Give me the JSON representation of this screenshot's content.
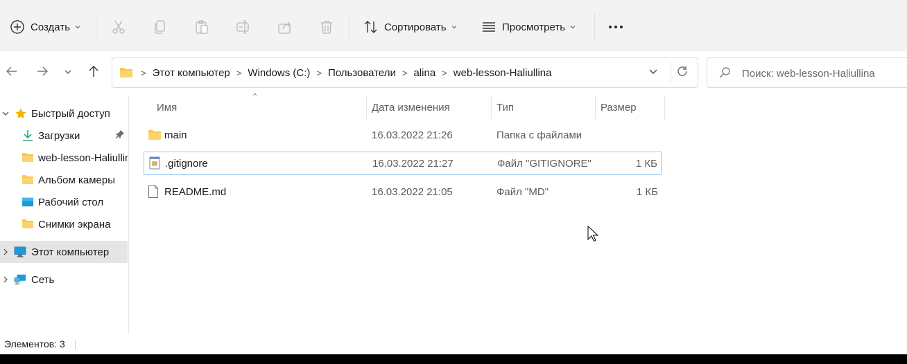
{
  "toolbar": {
    "new_label": "Создать",
    "sort_label": "Сортировать",
    "view_label": "Просмотреть"
  },
  "address": {
    "crumbs": [
      "Этот компьютер",
      "Windows (C:)",
      "Пользователи",
      "alina",
      "web-lesson-Haliullina"
    ]
  },
  "search": {
    "placeholder": "Поиск: web-lesson-Haliullina"
  },
  "sidebar": {
    "items": [
      {
        "label": "Быстрый доступ"
      },
      {
        "label": "Загрузки"
      },
      {
        "label": "web-lesson-Haliullina"
      },
      {
        "label": "Альбом камеры"
      },
      {
        "label": "Рабочий стол"
      },
      {
        "label": "Снимки экрана"
      },
      {
        "label": "Этот компьютер"
      },
      {
        "label": "Сеть"
      }
    ]
  },
  "columns": {
    "name": "Имя",
    "date": "Дата изменения",
    "type": "Тип",
    "size": "Размер"
  },
  "files": [
    {
      "name": "main",
      "date": "16.03.2022 21:26",
      "type": "Папка с файлами",
      "size": ""
    },
    {
      "name": ".gitignore",
      "date": "16.03.2022 21:27",
      "type": "Файл \"GITIGNORE\"",
      "size": "1 КБ"
    },
    {
      "name": "README.md",
      "date": "16.03.2022 21:05",
      "type": "Файл \"MD\"",
      "size": "1 КБ"
    }
  ],
  "status": {
    "items_count": "Элементов: 3"
  },
  "colors": {
    "folder": "#f8c74b",
    "accent": "#0067c0",
    "selection_border": "#99c9ef"
  }
}
